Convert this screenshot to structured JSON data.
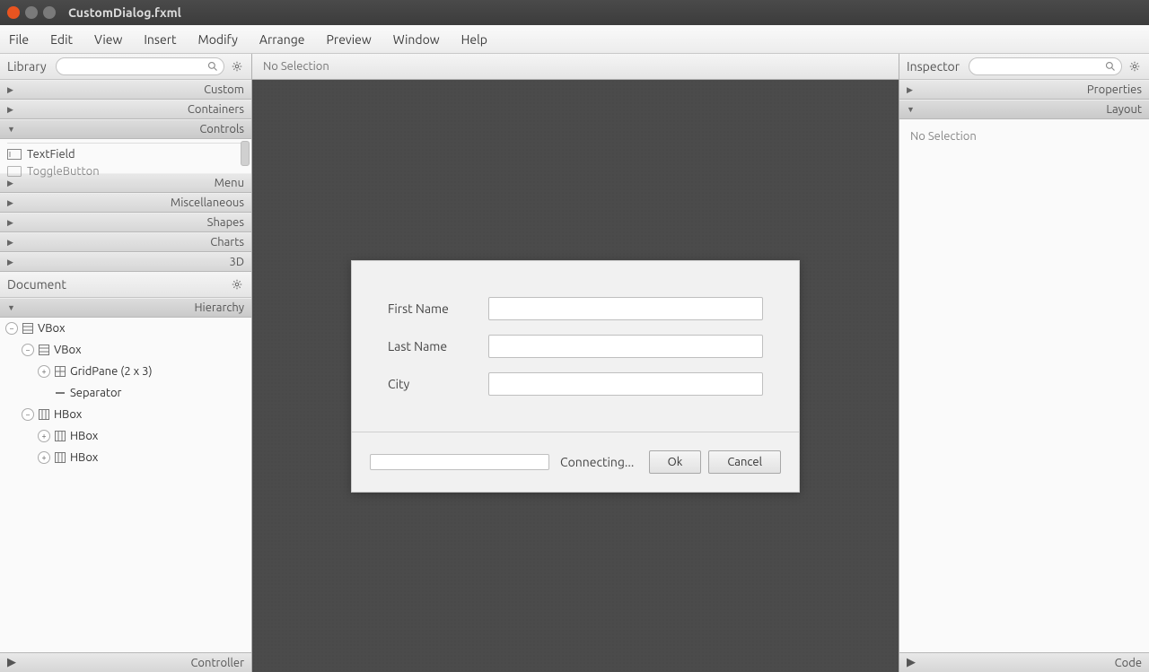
{
  "window": {
    "title": "CustomDialog.fxml"
  },
  "menu": {
    "file": "File",
    "edit": "Edit",
    "view": "View",
    "insert": "Insert",
    "modify": "Modify",
    "arrange": "Arrange",
    "preview": "Preview",
    "window": "Window",
    "help": "Help"
  },
  "library": {
    "title": "Library",
    "sections": {
      "custom": "Custom",
      "containers": "Containers",
      "controls": "Controls",
      "menu": "Menu",
      "miscellaneous": "Miscellaneous",
      "shapes": "Shapes",
      "charts": "Charts",
      "threed": "3D"
    },
    "controlsVisible": {
      "item1": "TextField",
      "item2": "ToggleButton"
    }
  },
  "document": {
    "title": "Document",
    "hierarchy": "Hierarchy",
    "controller": "Controller",
    "tree": {
      "n0": "VBox",
      "n1": "VBox",
      "n2": "GridPane (2 x 3)",
      "n3": "Separator",
      "n4": "HBox",
      "n5": "HBox",
      "n6": "HBox"
    }
  },
  "center": {
    "header": "No Selection",
    "form": {
      "firstName": "First Name",
      "lastName": "Last Name",
      "city": "City"
    },
    "footer": {
      "status": "Connecting...",
      "ok": "Ok",
      "cancel": "Cancel"
    }
  },
  "inspector": {
    "title": "Inspector",
    "properties": "Properties",
    "layout": "Layout",
    "code": "Code",
    "noSelection": "No Selection"
  }
}
